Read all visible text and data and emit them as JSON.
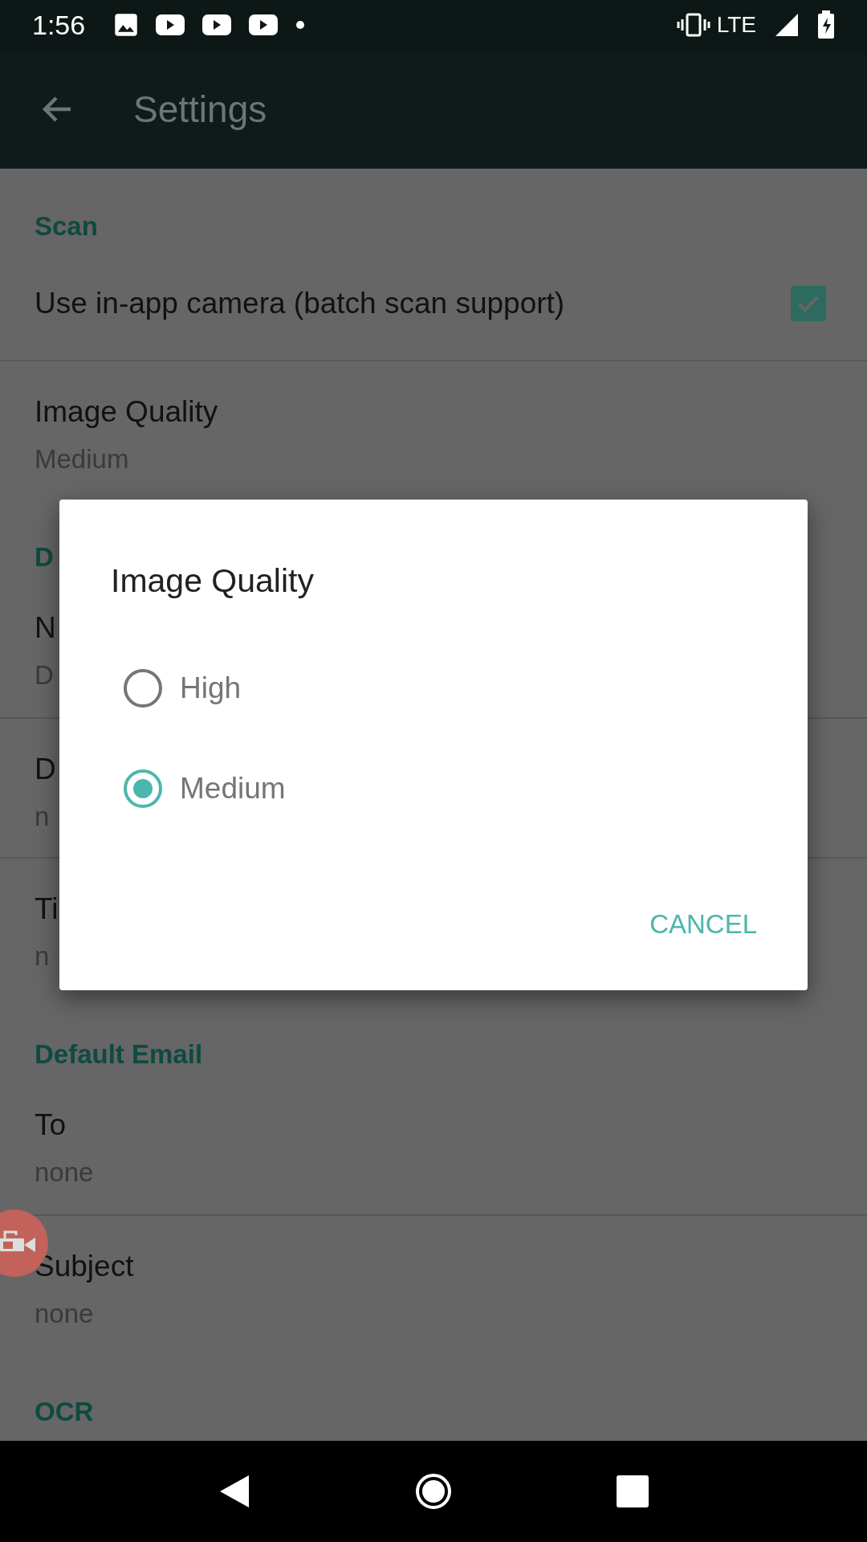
{
  "status_bar": {
    "time": "1:56",
    "network": "LTE"
  },
  "app_bar": {
    "title": "Settings"
  },
  "sections": [
    {
      "header": "Scan",
      "items": [
        {
          "kind": "checkbox",
          "title": "Use in-app camera (batch scan support)",
          "checked": true
        },
        {
          "kind": "value",
          "title": "Image Quality",
          "summary": "Medium"
        }
      ]
    },
    {
      "header": "D",
      "items": [
        {
          "kind": "value",
          "title": "N",
          "summary": "D"
        },
        {
          "kind": "value",
          "title": "D",
          "summary": "n"
        },
        {
          "kind": "value",
          "title": "Ti",
          "summary": "n"
        }
      ]
    },
    {
      "header": "Default Email",
      "items": [
        {
          "kind": "value",
          "title": "To",
          "summary": "none"
        },
        {
          "kind": "value",
          "title": "Subject",
          "summary": "none"
        }
      ]
    },
    {
      "header": "OCR"
    }
  ],
  "dialog": {
    "title": "Image Quality",
    "options": [
      {
        "label": "High",
        "selected": false
      },
      {
        "label": "Medium",
        "selected": true
      }
    ],
    "button": "CANCEL"
  }
}
